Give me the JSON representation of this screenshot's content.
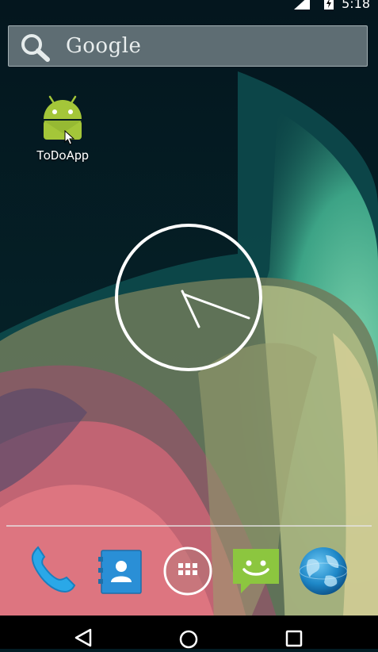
{
  "status_bar": {
    "time": "5:18",
    "signal_icon": "cell-signal-icon",
    "battery_icon": "battery-charging-icon"
  },
  "search_widget": {
    "label": "Google",
    "icon": "search-icon"
  },
  "home_screen": {
    "shortcuts": [
      {
        "label": "ToDoApp",
        "icon": "android-robot-icon",
        "color": "#a4c639"
      }
    ],
    "clock": {
      "type": "analog",
      "hour_hand": "5",
      "minute_hand": "18"
    }
  },
  "dock": {
    "items": [
      {
        "name": "phone",
        "icon": "phone-icon",
        "color": "#2aa8e8"
      },
      {
        "name": "people",
        "icon": "contacts-icon",
        "color": "#2a8fd6"
      },
      {
        "name": "all-apps",
        "icon": "app-drawer-icon",
        "color": "#ffffff"
      },
      {
        "name": "messaging",
        "icon": "messaging-icon",
        "color": "#8cc63f"
      },
      {
        "name": "browser",
        "icon": "globe-icon",
        "color": "#1e88c8"
      }
    ]
  },
  "nav_bar": {
    "buttons": [
      "back-icon",
      "home-icon",
      "recents-icon"
    ]
  }
}
